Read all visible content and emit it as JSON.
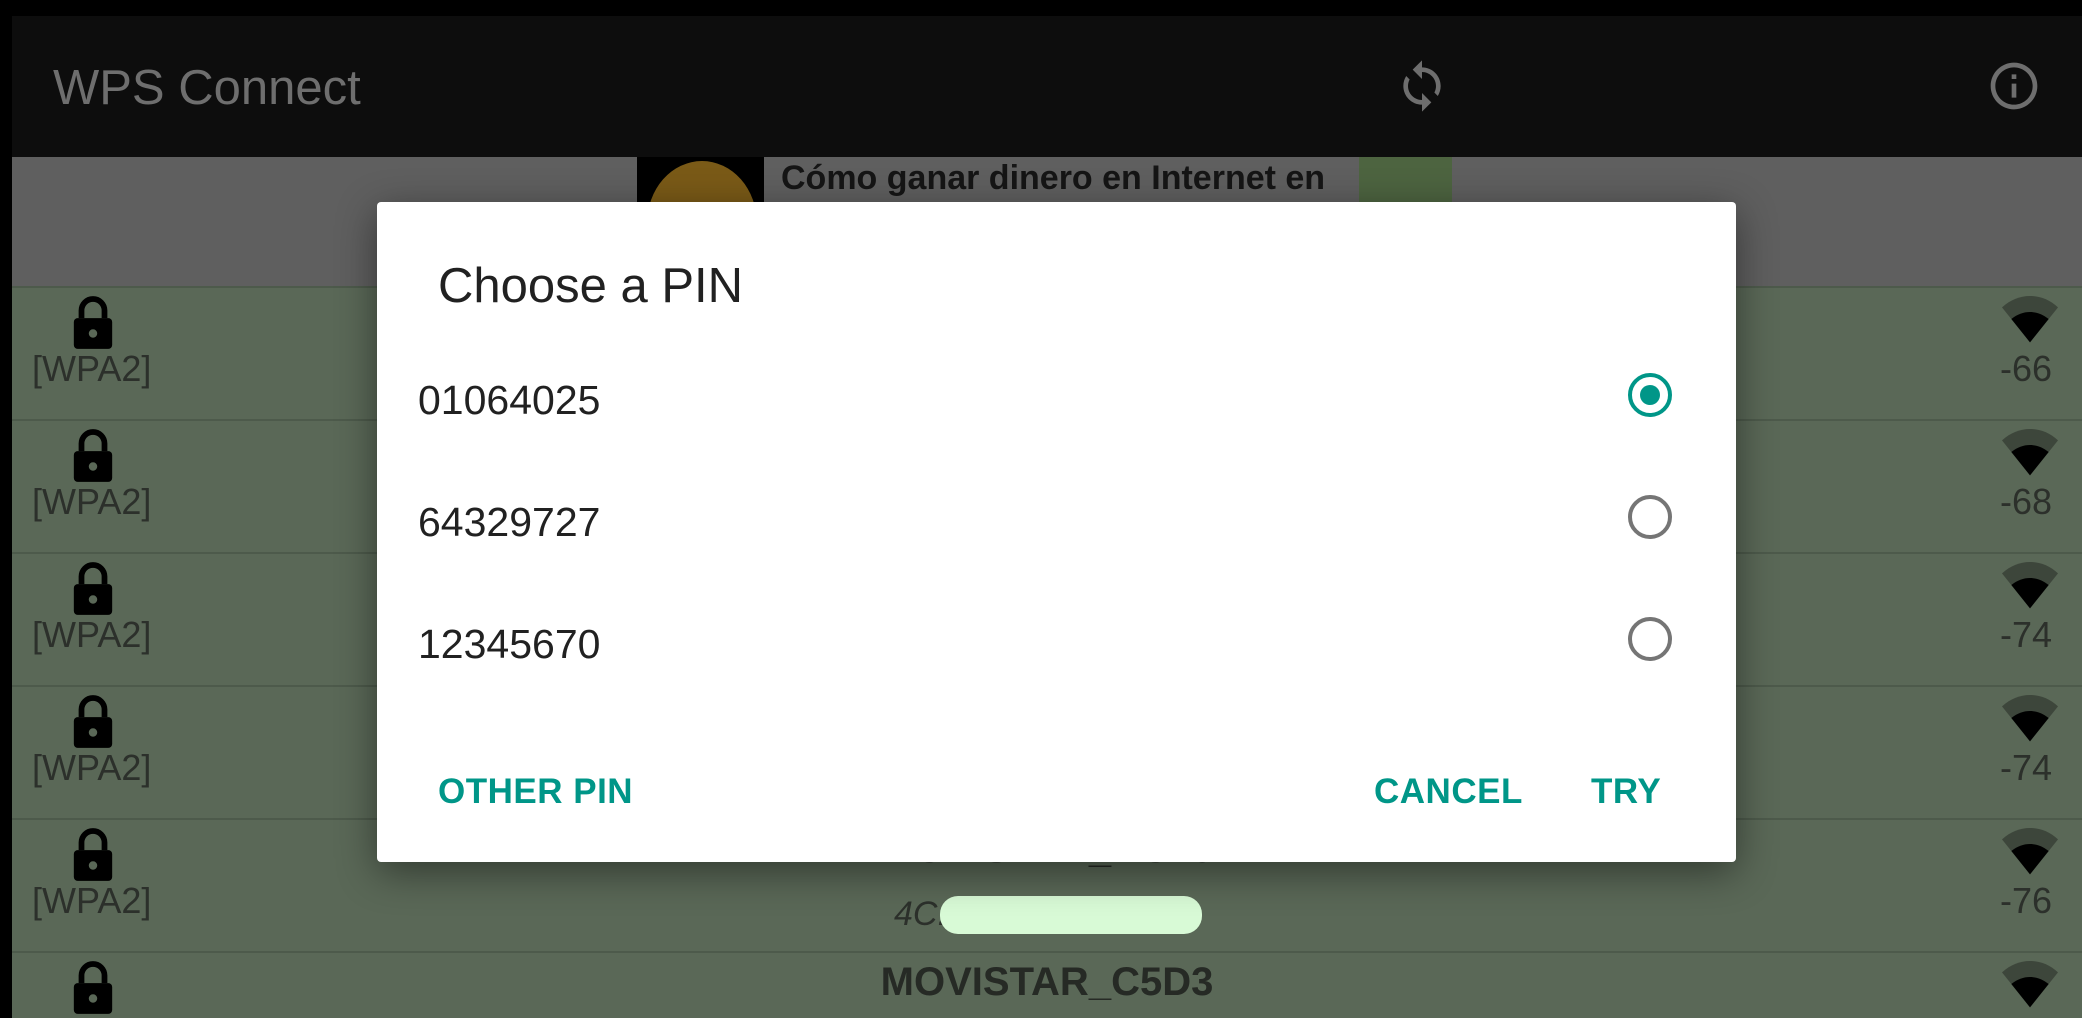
{
  "toolbar": {
    "title": "WPS Connect",
    "icons": [
      "refresh-icon",
      "info-icon"
    ]
  },
  "ad": {
    "text": "Cómo ganar dinero en Internet en"
  },
  "networks": [
    {
      "security": "[WPA2]",
      "rssi": "-66",
      "ssid": "",
      "bssid": ""
    },
    {
      "security": "[WPA2]",
      "rssi": "-68",
      "ssid": "",
      "bssid": ""
    },
    {
      "security": "[WPA2]",
      "rssi": "-74",
      "ssid": "",
      "bssid": ""
    },
    {
      "security": "[WPA2]",
      "rssi": "-74",
      "ssid": "",
      "bssid": ""
    },
    {
      "security": "[WPA2]",
      "rssi": "-76",
      "ssid": "MOVISTAR_DC40",
      "bssid": "4C:A"
    },
    {
      "security": "",
      "rssi": "",
      "ssid": "MOVISTAR_C5D3",
      "bssid": ""
    }
  ],
  "dialog": {
    "title": "Choose a PIN",
    "options": [
      {
        "label": "01064025",
        "selected": true
      },
      {
        "label": "64329727",
        "selected": false
      },
      {
        "label": "12345670",
        "selected": false
      }
    ],
    "buttons": {
      "other": "OTHER PIN",
      "cancel": "CANCEL",
      "try": "TRY"
    },
    "accent": "#009688"
  }
}
